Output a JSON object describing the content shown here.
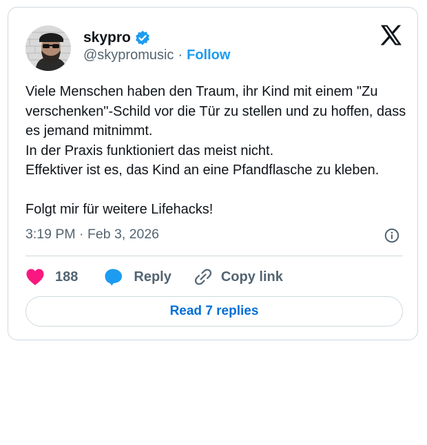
{
  "author": {
    "display_name": "skypro",
    "handle": "@skypromusic",
    "separator": "·",
    "follow_label": "Follow",
    "verified_color": "#1d9bf0"
  },
  "tweet": {
    "text": "Viele Menschen haben den Traum, ihr Kind mit einem \"Zu verschenken\"-Schild vor die Tür zu stellen und zu hoffen, dass es jemand mitnimmt.\nIn der Praxis funktioniert das meist nicht.\nEffektiver ist es, das Kind an eine Pfandflasche zu kleben.\n\nFolgt mir für weitere Lifehacks!",
    "timestamp": "3:19 PM · Feb 3, 2026"
  },
  "actions": {
    "like_count": "188",
    "like_color": "#f91880",
    "reply_label": "Reply",
    "reply_color": "#1d9bf0",
    "copy_label": "Copy link"
  },
  "read_replies_label": "Read 7 replies",
  "icons": [
    "x-logo-icon",
    "verified-badge-icon",
    "info-icon",
    "heart-icon",
    "reply-bubble-icon",
    "link-icon"
  ]
}
